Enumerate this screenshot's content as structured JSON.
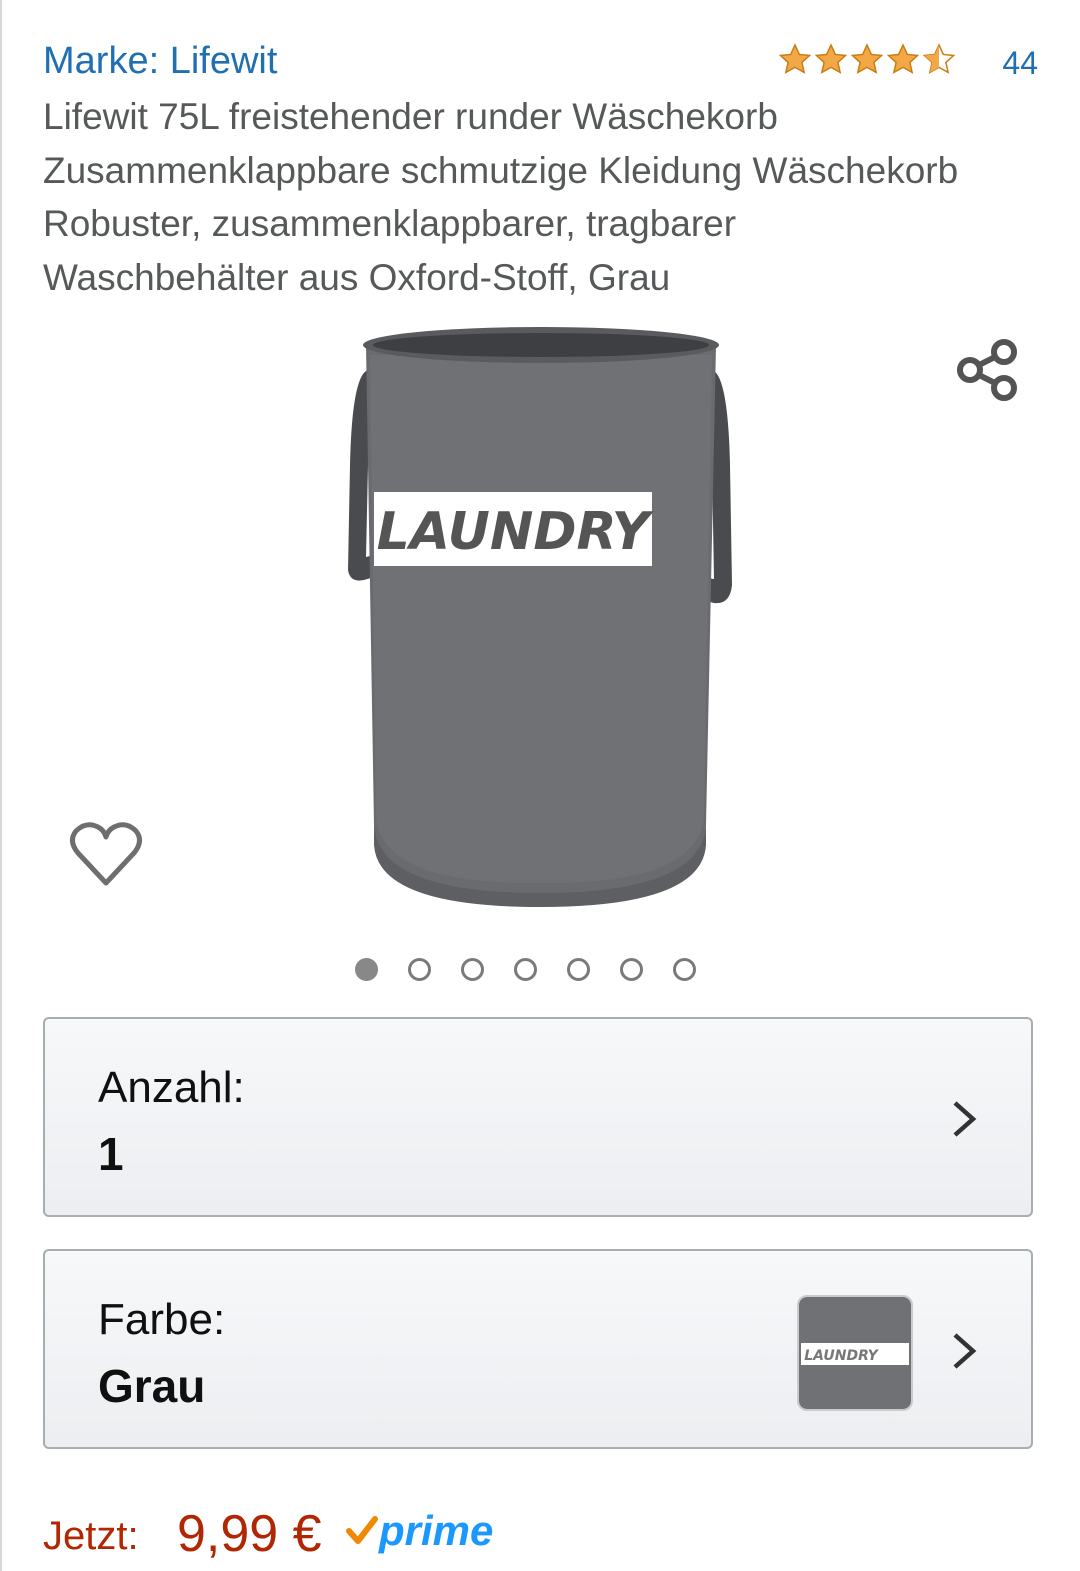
{
  "brand": {
    "label": "Marke: Lifewit"
  },
  "rating": {
    "stars": 4.5,
    "max": 5,
    "count": "44",
    "star_color": "#f3a847"
  },
  "product": {
    "title_lines": [
      "Lifewit 75L freistehender runder Wäschekorb",
      "Zusammenklappbare schmutzige Kleidung Wäschekorb",
      "Robuster, zusammenklappbarer, tragbarer",
      "Waschbehälter aus Oxford-Stoff, Grau"
    ],
    "image_label": "LAUNDRY"
  },
  "icons": {
    "share": "share-icon",
    "wishlist": "heart-icon",
    "chevron": "chevron-right-icon",
    "prime_check": "check-icon"
  },
  "gallery": {
    "count": 7,
    "active_index": 0
  },
  "quantity": {
    "label": "Anzahl:",
    "value": "1"
  },
  "color": {
    "label": "Farbe:",
    "value": "Grau",
    "thumb_label": "LAUNDRY"
  },
  "price": {
    "label": "Jetzt:",
    "value": "9,99 €",
    "prime_label": "prime",
    "price_color": "#b12704",
    "prime_color": "#1a98ff"
  }
}
